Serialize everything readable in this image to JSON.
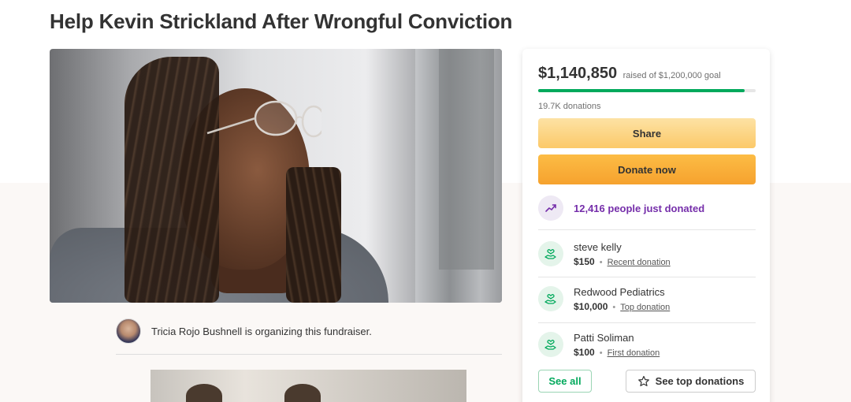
{
  "page": {
    "title": "Help Kevin Strickland After Wrongful Conviction"
  },
  "organizer": {
    "text": "Tricia Rojo Bushnell is organizing this fundraiser."
  },
  "card": {
    "raised_amount": "$1,140,850",
    "raised_goal": "raised of $1,200,000 goal",
    "progress_fraction": 0.95,
    "donations_count": "19.7K donations",
    "share_label": "Share",
    "donate_label": "Donate now",
    "trend_text": "12,416 people just donated",
    "donors": [
      {
        "name": "steve kelly",
        "amount": "$150",
        "type": "Recent donation"
      },
      {
        "name": "Redwood Pediatrics",
        "amount": "$10,000",
        "type": "Top donation"
      },
      {
        "name": "Patti Soliman",
        "amount": "$100",
        "type": "First donation"
      }
    ],
    "see_all_label": "See all",
    "see_top_label": "See top donations"
  },
  "icons": {
    "trend": "trending-up-icon",
    "donor": "heart-hand-icon",
    "star": "star-icon"
  },
  "colors": {
    "progress": "#02a95c",
    "trend_text": "#752eaa",
    "donate": "#f6a22e",
    "share": "#fcc969"
  }
}
